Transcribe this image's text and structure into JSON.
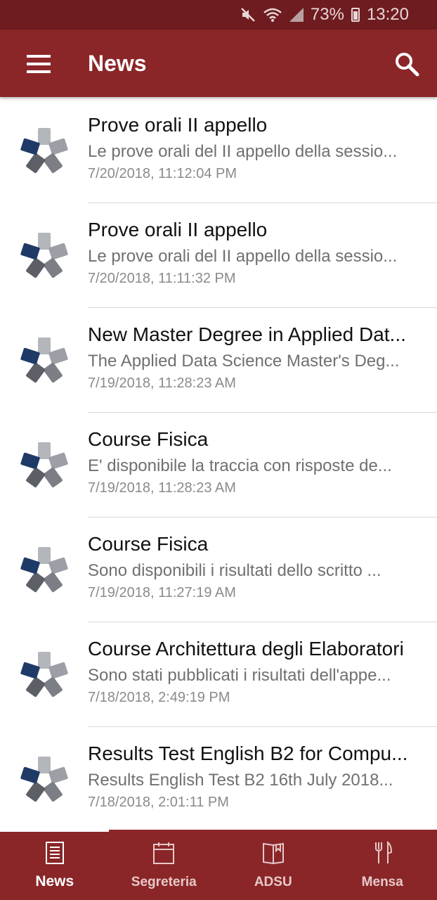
{
  "status_bar": {
    "battery": "73%",
    "time": "13:20"
  },
  "app_bar": {
    "title": "News"
  },
  "news": [
    {
      "title": "Prove orali II appello",
      "summary": "Le prove orali del II appello della sessio...",
      "date": "7/20/2018, 11:12:04 PM"
    },
    {
      "title": "Prove orali II appello",
      "summary": "Le prove orali del II appello della sessio...",
      "date": "7/20/2018, 11:11:32 PM"
    },
    {
      "title": "New Master Degree in Applied Dat...",
      "summary": "The Applied Data Science Master's Deg...",
      "date": "7/19/2018, 11:28:23 AM"
    },
    {
      "title": "Course Fisica",
      "summary": "E' disponibile la traccia con risposte de...",
      "date": "7/19/2018, 11:28:23 AM"
    },
    {
      "title": "Course Fisica",
      "summary": "Sono disponibili i risultati dello scritto ...",
      "date": "7/19/2018, 11:27:19 AM"
    },
    {
      "title": "Course Architettura degli Elaboratori",
      "summary": "Sono stati pubblicati i risultati dell'appe...",
      "date": "7/18/2018, 2:49:19 PM"
    },
    {
      "title": "Results Test English B2 for Compu...",
      "summary": "Results English Test B2 16th July 2018...",
      "date": "7/18/2018, 2:01:11 PM"
    }
  ],
  "bottom_nav": [
    {
      "label": "News",
      "icon": "newspaper-icon",
      "active": true
    },
    {
      "label": "Segreteria",
      "icon": "calendar-icon",
      "active": false
    },
    {
      "label": "ADSU",
      "icon": "book-icon",
      "active": false
    },
    {
      "label": "Mensa",
      "icon": "cutlery-icon",
      "active": false
    }
  ],
  "colors": {
    "status_bar": "#6e1c20",
    "primary": "#8a2628",
    "text": "#111111",
    "secondary_text": "#707070",
    "divider": "#d8d8d8"
  }
}
